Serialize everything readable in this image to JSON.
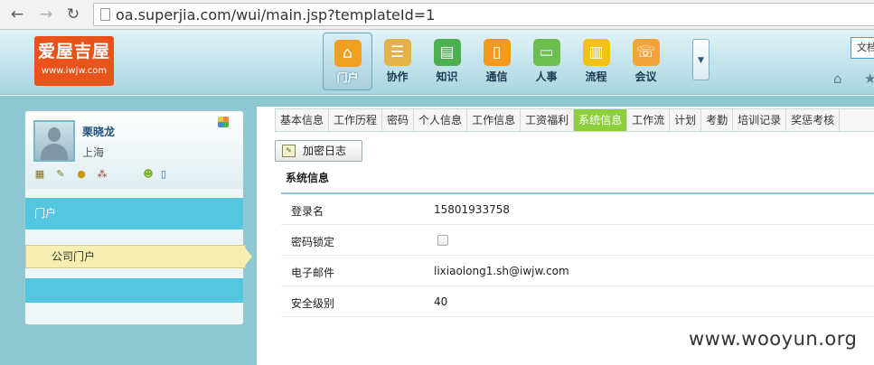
{
  "browser": {
    "url": "oa.superjia.com/wui/main.jsp?templateId=1",
    "back_icon": "arrow-left-icon",
    "forward_icon": "arrow-right-icon",
    "reload_icon": "reload-icon"
  },
  "header": {
    "logo_main": "爱屋吉屋",
    "logo_sub": "www.iwjw.com",
    "modules": [
      {
        "label": "门户",
        "icon": "home-icon",
        "color": "#f0a020"
      },
      {
        "label": "协作",
        "icon": "clipboard-icon",
        "color": "#e3b34a"
      },
      {
        "label": "知识",
        "icon": "books-icon",
        "color": "#4caf50"
      },
      {
        "label": "通信",
        "icon": "phone-icon",
        "color": "#f39a1e"
      },
      {
        "label": "人事",
        "icon": "id-card-icon",
        "color": "#6bbf4e"
      },
      {
        "label": "流程",
        "icon": "bar-chart-icon",
        "color": "#f2c21a"
      },
      {
        "label": "会议",
        "icon": "meeting-icon",
        "color": "#f0a43a"
      }
    ],
    "right_box_text": "文档"
  },
  "left": {
    "user_name": "栗晓龙",
    "user_city": "上海",
    "menu_portal": "门户",
    "menu_company": "公司门户"
  },
  "content": {
    "tabs": [
      "基本信息",
      "工作历程",
      "密码",
      "个人信息",
      "工作信息",
      "工资福利",
      "系统信息",
      "工作流",
      "计划",
      "考勤",
      "培训记录",
      "奖惩考核"
    ],
    "active_tab": "系统信息",
    "log_button": "加密日志",
    "section_title": "系统信息",
    "rows": [
      {
        "label": "登录名",
        "value": "15801933758"
      },
      {
        "label": "密码锁定",
        "value": ""
      },
      {
        "label": "电子邮件",
        "value": "lixiaolong1.sh@iwjw.com"
      },
      {
        "label": "安全级别",
        "value": "40"
      }
    ],
    "password_locked": false
  },
  "watermark": "www.wooyun.org"
}
